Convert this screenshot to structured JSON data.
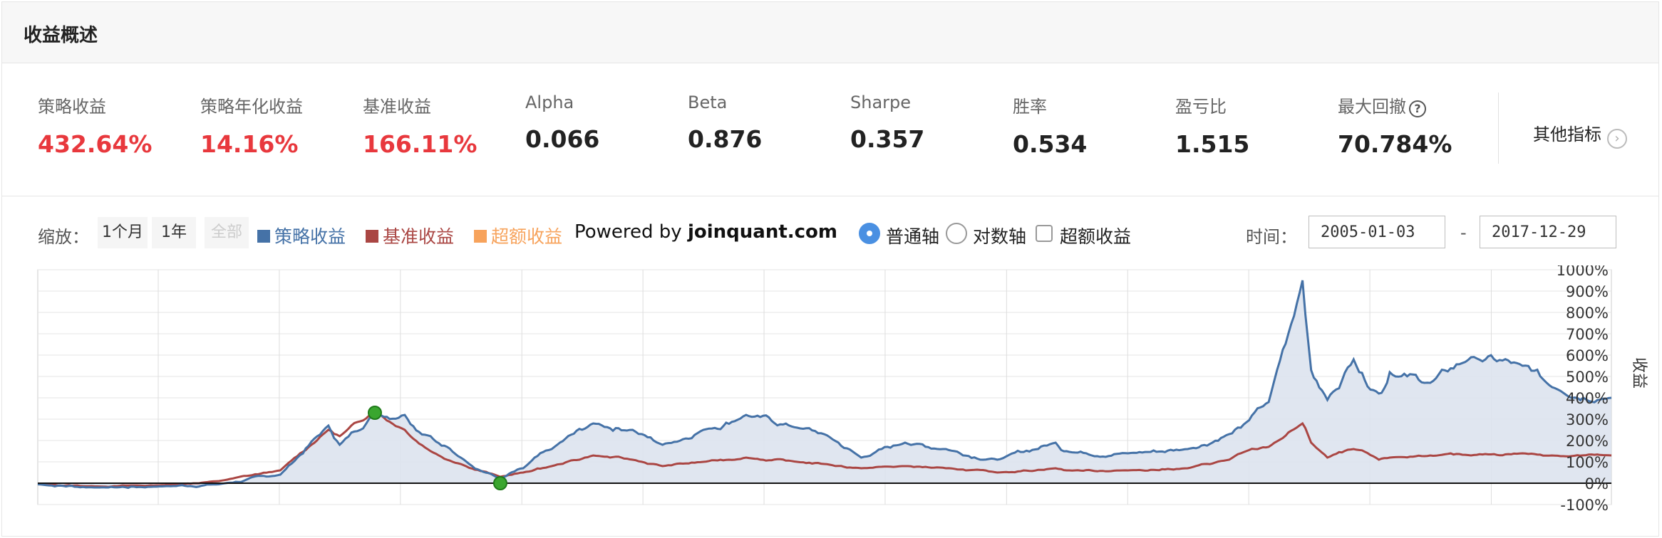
{
  "header": {
    "title": "收益概述"
  },
  "stats": [
    {
      "label": "策略收益",
      "value": "432.64%",
      "red": true
    },
    {
      "label": "策略年化收益",
      "value": "14.16%",
      "red": true
    },
    {
      "label": "基准收益",
      "value": "166.11%",
      "red": true
    },
    {
      "label": "Alpha",
      "value": "0.066",
      "red": false
    },
    {
      "label": "Beta",
      "value": "0.876",
      "red": false
    },
    {
      "label": "Sharpe",
      "value": "0.357",
      "red": false
    },
    {
      "label": "胜率",
      "value": "0.534",
      "red": false
    },
    {
      "label": "盈亏比",
      "value": "1.515",
      "red": false
    },
    {
      "label": "最大回撤",
      "value": "70.784%",
      "red": false
    }
  ],
  "help_icon_glyph": "?",
  "other_metrics": {
    "label": "其他指标",
    "icon": "chevron-right-icon",
    "glyph": "›"
  },
  "toolbar": {
    "zoom_label": "缩放：",
    "zoom_buttons": [
      "1个月",
      "1年",
      "全部"
    ],
    "legend": [
      {
        "name": "策略收益",
        "color": "#4572a7"
      },
      {
        "name": "基准收益",
        "color": "#aa4643"
      },
      {
        "name": "超额收益",
        "color": "#f7a35c"
      }
    ],
    "powered_prefix": "Powered by",
    "powered_site": "joinquant.com",
    "axis_options": [
      "普通轴",
      "对数轴"
    ],
    "axis_selected": "普通轴",
    "excess_checkbox_label": "超额收益",
    "excess_checked": false,
    "time_label": "时间：",
    "start_date": "2005-01-03",
    "dash": "-",
    "end_date": "2017-12-29"
  },
  "colors": {
    "strategy": "#4572a7",
    "benchmark": "#aa4643",
    "excess": "#f7a35c",
    "positive": "#e8383d",
    "area_fill": "#dde3ee",
    "marker": "#3aa62f"
  },
  "chart_data": {
    "type": "line",
    "x_range": [
      "2005-01-03",
      "2017-12-29"
    ],
    "ylim": [
      -100,
      1000
    ],
    "y_ticks": [
      "1000%",
      "900%",
      "800%",
      "700%",
      "600%",
      "500%",
      "400%",
      "300%",
      "200%",
      "100%",
      "0%",
      "-100%"
    ],
    "ylabel": "收益",
    "grid": true,
    "series": [
      {
        "name": "策略收益",
        "x": [
          "2005-01-03",
          "2005-07-01",
          "2006-01-04",
          "2006-07-03",
          "2007-01-04",
          "2007-05-29",
          "2007-07-02",
          "2007-10-16",
          "2008-01-14",
          "2008-04-01",
          "2008-07-01",
          "2008-10-28",
          "2009-01-05",
          "2009-04-01",
          "2009-08-04",
          "2009-12-01",
          "2010-03-01",
          "2010-07-02",
          "2010-11-08",
          "2011-04-11",
          "2011-07-01",
          "2011-10-21",
          "2012-03-01",
          "2012-07-02",
          "2012-12-04",
          "2013-05-29",
          "2013-07-01",
          "2014-01-02",
          "2014-07-01",
          "2014-11-03",
          "2014-12-08",
          "2015-03-02",
          "2015-06-12",
          "2015-07-08",
          "2015-08-26",
          "2015-11-13",
          "2016-01-28",
          "2016-03-01",
          "2016-07-01",
          "2016-11-01",
          "2017-04-05",
          "2017-07-03",
          "2017-12-29"
        ],
        "values": [
          -5,
          -20,
          -15,
          -5,
          40,
          270,
          180,
          330,
          320,
          220,
          120,
          20,
          70,
          160,
          280,
          250,
          180,
          250,
          320,
          260,
          230,
          120,
          190,
          160,
          110,
          190,
          150,
          140,
          160,
          230,
          260,
          380,
          950,
          530,
          390,
          580,
          420,
          520,
          470,
          590,
          550,
          450,
          400
        ]
      },
      {
        "name": "基准收益",
        "x": [
          "2005-01-03",
          "2005-07-01",
          "2006-01-04",
          "2006-07-03",
          "2007-01-04",
          "2007-05-29",
          "2007-07-02",
          "2007-10-16",
          "2008-01-14",
          "2008-04-01",
          "2008-07-01",
          "2008-10-28",
          "2009-01-05",
          "2009-04-01",
          "2009-08-04",
          "2009-12-01",
          "2010-03-01",
          "2010-07-02",
          "2010-11-08",
          "2011-04-11",
          "2011-07-01",
          "2011-10-21",
          "2012-03-01",
          "2012-07-02",
          "2012-12-04",
          "2013-05-29",
          "2013-07-01",
          "2014-01-02",
          "2014-07-01",
          "2014-11-03",
          "2014-12-08",
          "2015-03-02",
          "2015-06-12",
          "2015-07-08",
          "2015-08-26",
          "2015-11-13",
          "2016-01-28",
          "2016-03-01",
          "2016-07-01",
          "2016-11-01",
          "2017-04-05",
          "2017-07-03",
          "2017-12-29"
        ],
        "values": [
          -5,
          -15,
          -10,
          10,
          60,
          250,
          220,
          340,
          250,
          150,
          90,
          30,
          50,
          80,
          130,
          110,
          80,
          100,
          120,
          100,
          90,
          70,
          80,
          70,
          50,
          70,
          60,
          60,
          70,
          110,
          140,
          170,
          280,
          190,
          120,
          160,
          110,
          120,
          130,
          130,
          140,
          130,
          130
        ]
      }
    ],
    "markers": [
      {
        "date": "2007-10-16",
        "value": 330
      },
      {
        "date": "2008-10-28",
        "value": 0
      }
    ]
  }
}
